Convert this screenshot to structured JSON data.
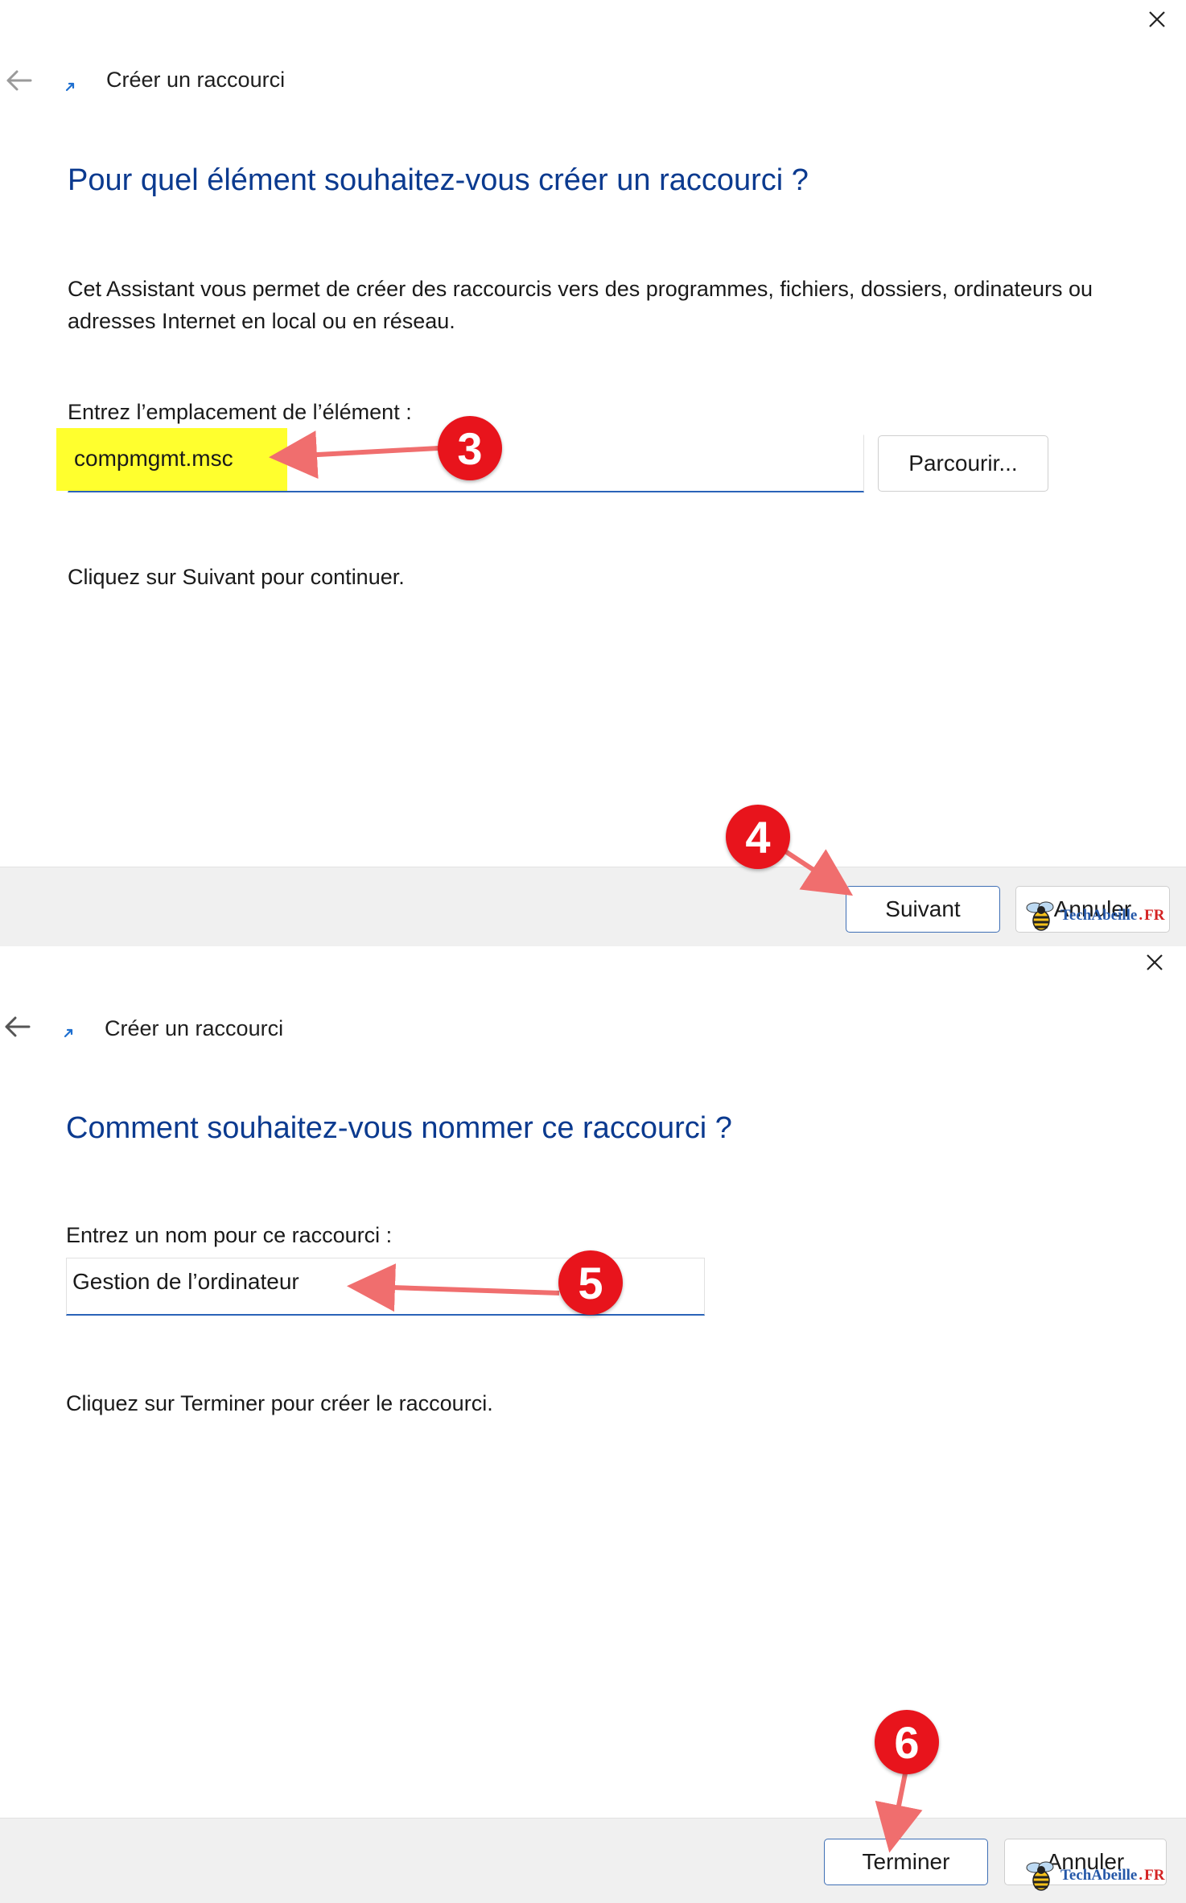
{
  "colors": {
    "heading": "#0b3a8f",
    "input_underline": "#2a63b8",
    "footer_bg": "#f0f0f0",
    "highlight": "#ffff2e",
    "annotation_red": "#e8141c",
    "arrow": "#f06e6e"
  },
  "icons": [
    "close-icon",
    "back-arrow-icon",
    "shortcut-arrow-icon",
    "bee-logo-icon"
  ],
  "dialog1": {
    "window_title": "Créer un raccourci",
    "heading": "Pour quel élément souhaitez-vous créer un raccourci ?",
    "description": "Cet Assistant vous permet de créer des raccourcis vers des programmes, fichiers, dossiers, ordinateurs ou adresses Internet en local ou en réseau.",
    "location_label": "Entrez l’emplacement de l’élément :",
    "location_value": "compmgmt.msc",
    "browse_label": "Parcourir...",
    "instruction": "Cliquez sur Suivant pour continuer.",
    "next_label": "Suivant",
    "cancel_label": "Annuler"
  },
  "dialog2": {
    "window_title": "Créer un raccourci",
    "heading": "Comment souhaitez-vous nommer ce raccourci ?",
    "name_label": "Entrez un nom pour ce raccourci :",
    "name_value": "Gestion de l’ordinateur",
    "instruction": "Cliquez sur Terminer pour créer le raccourci.",
    "finish_label": "Terminer",
    "cancel_label": "Annuler"
  },
  "annotations": {
    "step3": "3",
    "step4": "4",
    "step5": "5",
    "step6": "6"
  },
  "watermark": {
    "brand": "TechAbeille",
    "dot": ".",
    "tld": "FR"
  }
}
